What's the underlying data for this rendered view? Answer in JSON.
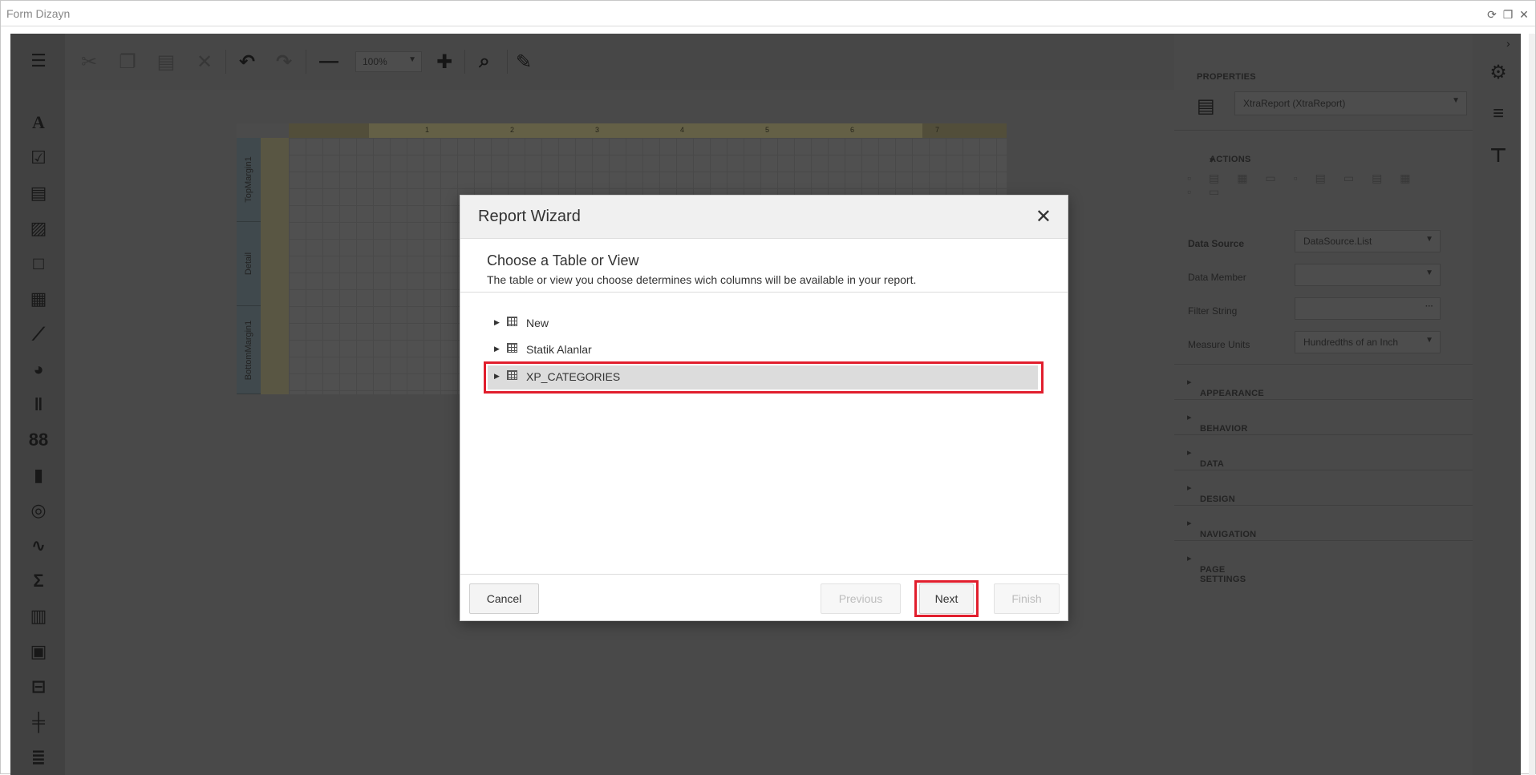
{
  "window": {
    "title": "Form Dizayn"
  },
  "toolbar": {
    "zoom": "100%"
  },
  "bands": [
    "TopMargin1",
    "Detail",
    "BottomMargin1"
  ],
  "ruler_ticks": [
    "1",
    "2",
    "3",
    "4",
    "5",
    "6",
    "7"
  ],
  "properties": {
    "header": "PROPERTIES",
    "object_select": "XtraReport (XtraReport)",
    "actions_label": "ACTIONS",
    "rows": [
      {
        "label": "Data Source",
        "value": "DataSource.List"
      },
      {
        "label": "Data Member",
        "value": ""
      },
      {
        "label": "Filter String",
        "value": ""
      },
      {
        "label": "Measure Units",
        "value": "Hundredths of an Inch"
      }
    ],
    "sections": [
      "APPEARANCE",
      "BEHAVIOR",
      "DATA",
      "DESIGN",
      "NAVIGATION",
      "PAGE SETTINGS"
    ]
  },
  "wizard": {
    "title": "Report Wizard",
    "step_title": "Choose a Table or View",
    "step_desc": "The table or view you choose determines wich columns will be available in your report.",
    "items": [
      "New",
      "Statik Alanlar",
      "XP_CATEGORIES"
    ],
    "selected_index": 2,
    "cancel": "Cancel",
    "previous": "Previous",
    "next": "Next",
    "finish": "Finish"
  }
}
